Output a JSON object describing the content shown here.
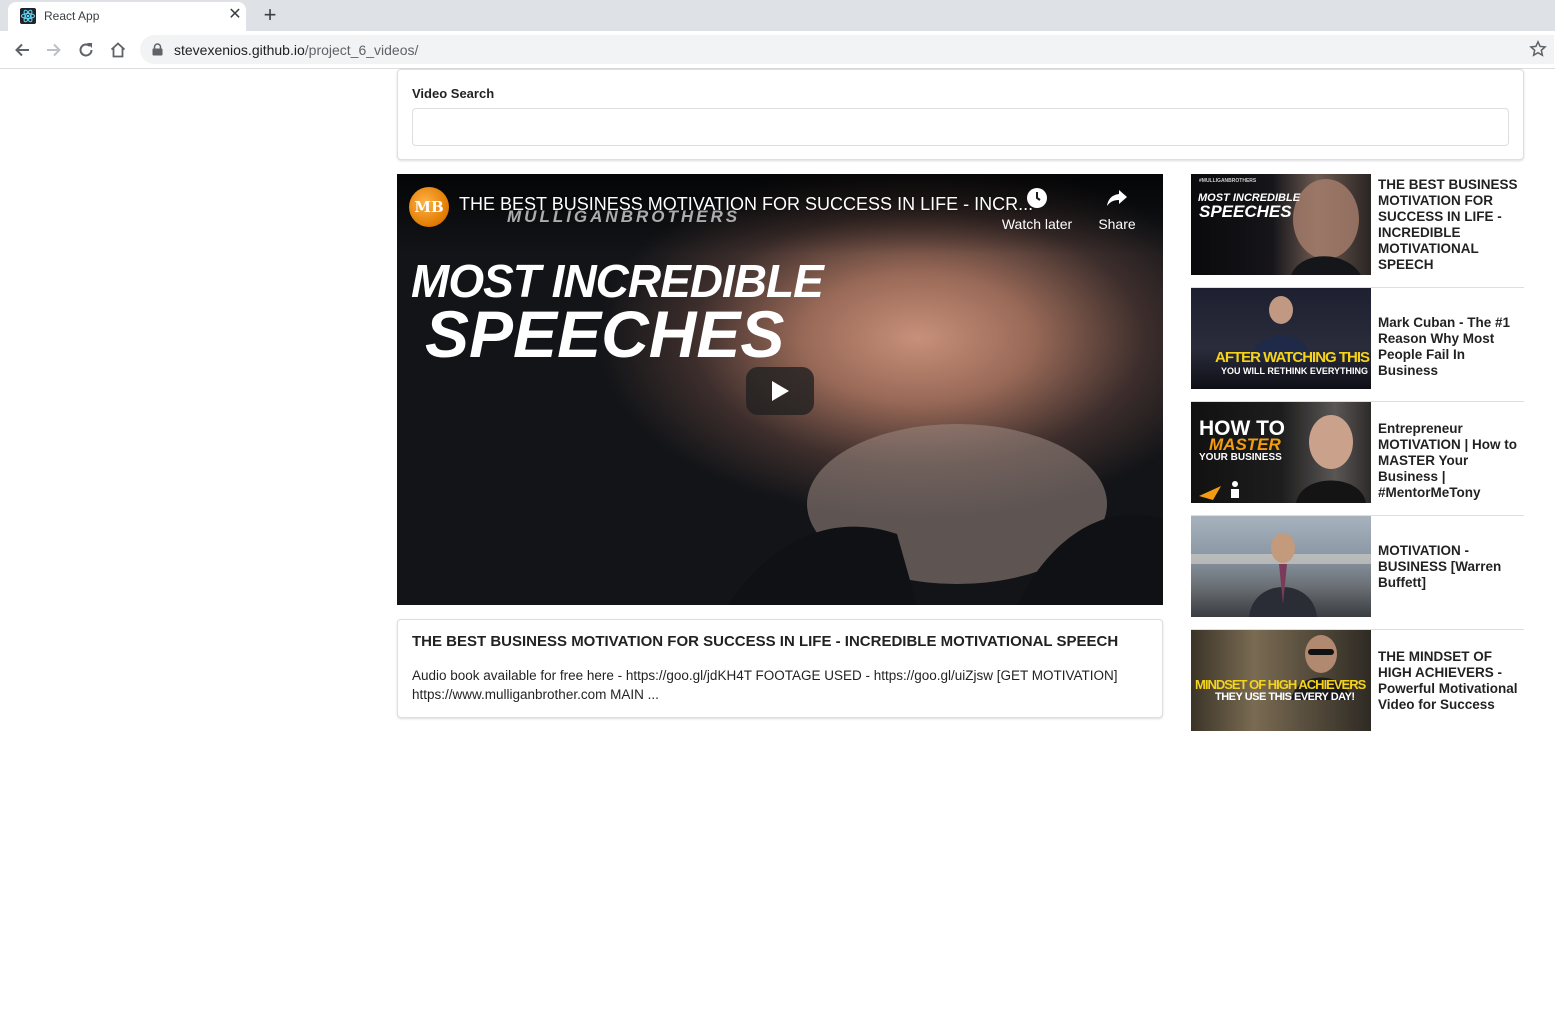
{
  "browser": {
    "tab_title": "React App",
    "url_host": "stevexenios.github.io",
    "url_path": "/project_6_videos/"
  },
  "search": {
    "label": "Video Search",
    "value": ""
  },
  "player": {
    "channel_logo_text": "MB",
    "title": "THE BEST BUSINESS MOTIVATION FOR SUCCESS IN LIFE - INCR...",
    "brand_overlay": "MULLIGANBROTHERS",
    "thumb_line1": "MOST INCREDIBLE",
    "thumb_line2": "SPEECHES",
    "watch_later_label": "Watch later",
    "share_label": "Share"
  },
  "detail": {
    "title": "THE BEST BUSINESS MOTIVATION FOR SUCCESS IN LIFE - INCREDIBLE MOTIVATIONAL SPEECH",
    "description": "Audio book available for free here - https://goo.gl/jdKH4T FOOTAGE USED - https://goo.gl/uiZjsw [GET MOTIVATION] https://www.mulliganbrother.com MAIN ..."
  },
  "videos": [
    {
      "title": "THE BEST BUSINESS MOTIVATION FOR SUCCESS IN LIFE - INCREDIBLE MOTIVATIONAL SPEECH",
      "thumb_top": "#MULLIGANBROTHERS",
      "thumb_line1": "MOST INCREDIBLE",
      "thumb_line2": "SPEECHES"
    },
    {
      "title": "Mark Cuban - The #1 Reason Why Most People Fail In Business",
      "thumb_line1": "AFTER WATCHING THIS",
      "thumb_line2": "YOU WILL RETHINK EVERYTHING"
    },
    {
      "title": "Entrepreneur MOTIVATION | How to MASTER Your Business | #MentorMeTony",
      "thumb_line1": "HOW TO",
      "thumb_line2": "MASTER",
      "thumb_line3": "YOUR BUSINESS"
    },
    {
      "title": "MOTIVATION - BUSINESS [Warren Buffett]"
    },
    {
      "title": "THE MINDSET OF HIGH ACHIEVERS - Powerful Motivational Video for Success",
      "thumb_line1": "MINDSET OF HIGH ACHIEVERS",
      "thumb_line2": "THEY USE THIS EVERY DAY!"
    }
  ],
  "colors": {
    "tabbar_bg": "#dee1e6",
    "omnibox_bg": "#f1f3f4",
    "thumb_yellow": "#f5d31b",
    "thumb_orange": "#f39c12"
  }
}
